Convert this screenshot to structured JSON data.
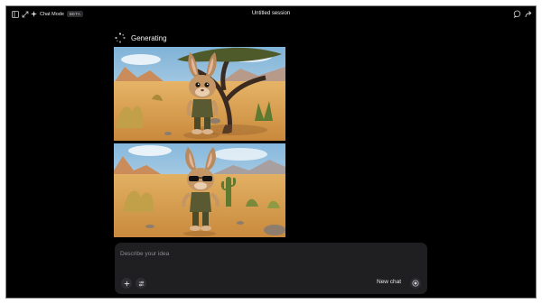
{
  "topbar": {
    "mode_label": "Chat Mode",
    "badge": "BETA",
    "title": "Untitled session",
    "icons": [
      "sidebar-icon",
      "collapse-icon",
      "sparkle-icon",
      "chat-icon",
      "share-icon"
    ]
  },
  "main": {
    "status_label": "Generating",
    "images": [
      {
        "name": "generated-image-1",
        "subject": "cartoon rabbit in desert under tree"
      },
      {
        "name": "generated-image-2",
        "subject": "cartoon rabbit with sunglasses in desert"
      }
    ]
  },
  "composer": {
    "placeholder": "Describe your idea",
    "new_chat_label": "New chat"
  },
  "colors": {
    "background": "#000000",
    "composer": "#1f1f22",
    "text": "#f2f2f2",
    "muted": "#8d8d93"
  }
}
